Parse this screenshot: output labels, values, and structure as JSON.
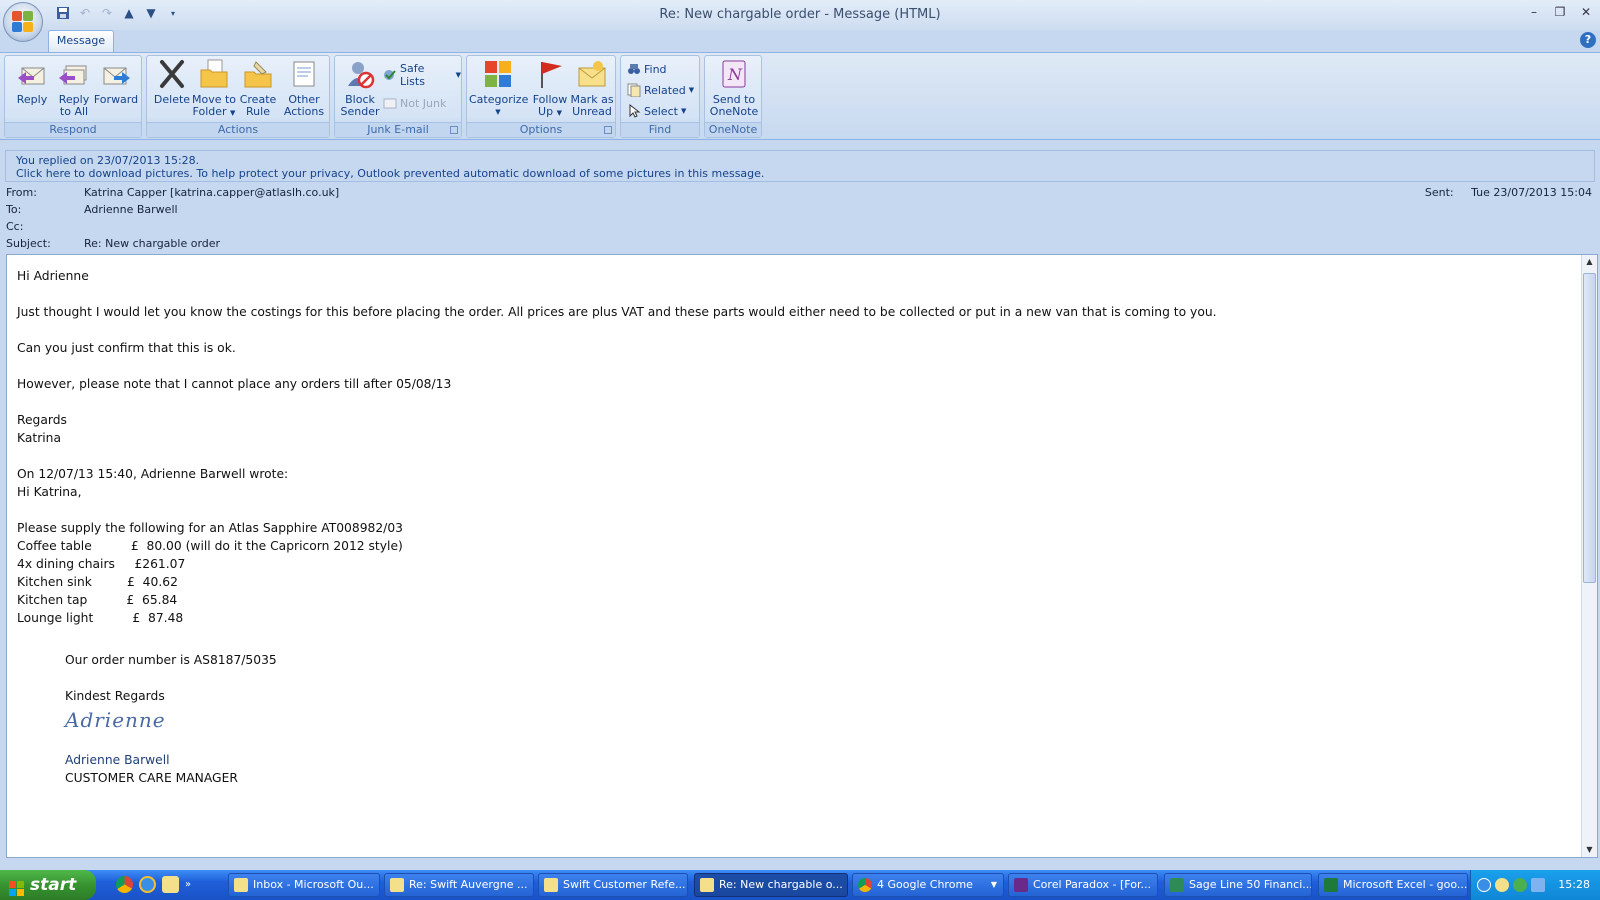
{
  "window": {
    "title": "Re: New chargable order - Message (HTML)"
  },
  "tabs": [
    {
      "label": "Message"
    }
  ],
  "ribbon": {
    "groups": {
      "respond": "Respond",
      "actions": "Actions",
      "junk": "Junk E-mail",
      "options": "Options",
      "find": "Find",
      "onenote": "OneNote"
    },
    "buttons": {
      "reply": [
        "Reply",
        ""
      ],
      "reply_all": [
        "Reply",
        "to All"
      ],
      "forward": [
        "Forward",
        ""
      ],
      "delete": [
        "Delete",
        ""
      ],
      "move_to_folder": [
        "Move to",
        "Folder"
      ],
      "create_rule": [
        "Create",
        "Rule"
      ],
      "other_actions": [
        "Other",
        "Actions"
      ],
      "block_sender": [
        "Block",
        "Sender"
      ],
      "categorize": [
        "Categorize",
        ""
      ],
      "follow_up": [
        "Follow",
        "Up"
      ],
      "mark_unread": [
        "Mark as",
        "Unread"
      ],
      "send_onenote": [
        "Send to",
        "OneNote"
      ]
    },
    "small_buttons": {
      "safe_lists": "Safe Lists",
      "not_junk": "Not Junk",
      "find": "Find",
      "related": "Related",
      "select": "Select"
    }
  },
  "infobar": {
    "line1": "You replied on 23/07/2013 15:28.",
    "line2": "Click here to download pictures. To help protect your privacy, Outlook prevented automatic download of some pictures in this message."
  },
  "headers": {
    "from_label": "From:",
    "from_value": "Katrina Capper [katrina.capper@atlaslh.co.uk]",
    "to_label": "To:",
    "to_value": "Adrienne Barwell",
    "cc_label": "Cc:",
    "cc_value": "",
    "subject_label": "Subject:",
    "subject_value": "Re: New chargable order",
    "sent_label": "Sent:",
    "sent_value": "Tue 23/07/2013 15:04"
  },
  "body": {
    "greeting": "Hi Adrienne",
    "p1": "Just thought I would let you know the costings for this before placing the order.  All prices are plus VAT and these parts would either need to be collected or put in a new van that is coming to you.",
    "p2": "Can you just confirm that this is ok.",
    "p3": "However, please note that I cannot place any orders till after 05/08/13",
    "regards": "Regards",
    "name": "Katrina",
    "quote_header": "On 12/07/13 15:40, Adrienne Barwell wrote:",
    "quote_greeting": "Hi Katrina,",
    "supply_line": "Please supply the following for an Atlas Sapphire AT008982/03",
    "items": [
      "Coffee table          £  80.00 (will do it the Capricorn 2012 style)",
      "4x dining chairs     £261.07",
      "Kitchen sink         £  40.62",
      "Kitchen tap          £  65.84",
      "Lounge light          £  87.48"
    ],
    "order_number": "Our order number is AS8187/5035",
    "kindest": "Kindest Regards",
    "signature_script": "Adrienne",
    "sig_name": "Adrienne Barwell",
    "sig_title": "CUSTOMER CARE MANAGER"
  },
  "taskbar": {
    "start": "start",
    "tasks": [
      "Inbox - Microsoft Ou...",
      "Re: Swift Auvergne ...",
      "Swift Customer Refe...",
      "Re: New chargable o...",
      "4 Google Chrome",
      "Corel Paradox - [For...",
      "Sage Line 50 Financi...",
      "Microsoft Excel - goo..."
    ],
    "clock": "15:28"
  },
  "colors": {
    "ribbon_bg": "#c7d9f0",
    "accent_text": "#15428b",
    "taskbar": "#1f5fd9",
    "start_green": "#37932f"
  }
}
